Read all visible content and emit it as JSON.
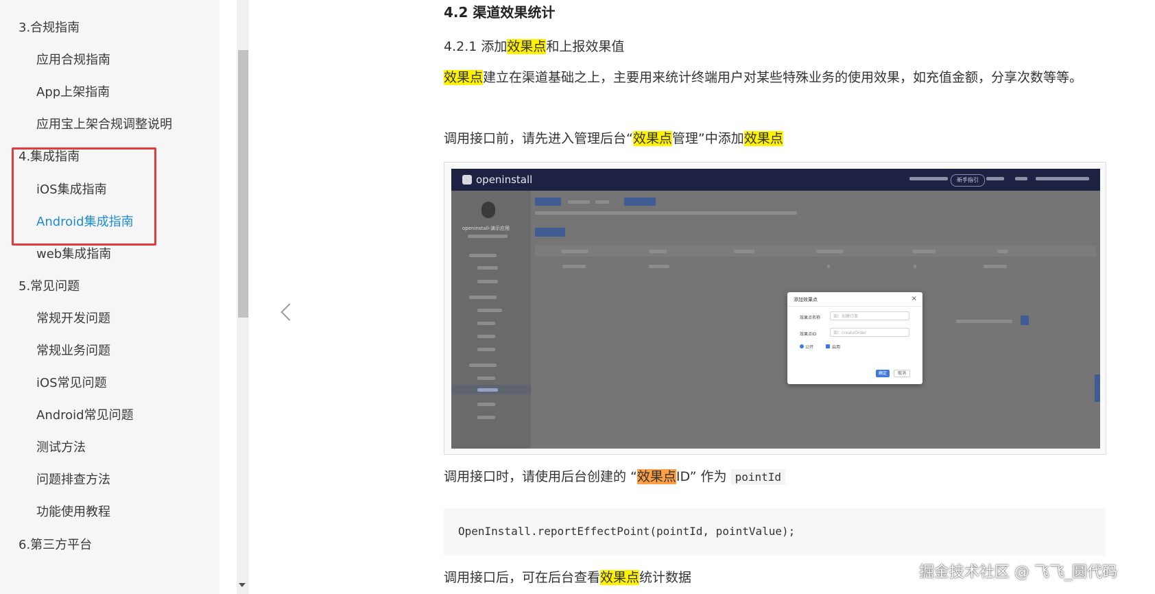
{
  "sidebar": {
    "items": [
      {
        "label": "3.合规指南",
        "level": 1
      },
      {
        "label": "应用合规指南",
        "level": 2
      },
      {
        "label": "App上架指南",
        "level": 2
      },
      {
        "label": "应用宝上架合规调整说明",
        "level": 2
      },
      {
        "label": "4.集成指南",
        "level": 1
      },
      {
        "label": "iOS集成指南",
        "level": 2
      },
      {
        "label": "Android集成指南",
        "level": 2,
        "active": true
      },
      {
        "label": "web集成指南",
        "level": 2
      },
      {
        "label": "5.常见问题",
        "level": 1
      },
      {
        "label": "常规开发问题",
        "level": 2
      },
      {
        "label": "常规业务问题",
        "level": 2
      },
      {
        "label": "iOS常见问题",
        "level": 2
      },
      {
        "label": "Android常见问题",
        "level": 2
      },
      {
        "label": "测试方法",
        "level": 2
      },
      {
        "label": "问题排查方法",
        "level": 2
      },
      {
        "label": "功能使用教程",
        "level": 2
      },
      {
        "label": "6.第三方平台",
        "level": 1
      }
    ],
    "active_color": "#1f8bd6",
    "highlight_color": "#e23b3b"
  },
  "article": {
    "heading": "4.2 渠道效果统计",
    "subheading": {
      "prefix": "4.2.1 添加",
      "highlight": "效果点",
      "suffix": "和上报效果值"
    },
    "para1": {
      "highlight": "效果点",
      "text": "建立在渠道基础之上，主要用来统计终端用户对某些特殊业务的使用效果，如充值金额，分享次数等等。"
    },
    "para2": {
      "prefix": "调用接口前，请先进入管理后台“",
      "highlight1": "效果点",
      "middle": "管理”中添加",
      "highlight2": "效果点"
    },
    "para3": {
      "prefix": "调用接口时，请使用后台创建的 “",
      "highlight": "效果点",
      "middle": "ID” 作为 ",
      "code": "pointId"
    },
    "code_block": "OpenInstall.reportEffectPoint(pointId, pointValue);",
    "para4": {
      "prefix": "调用接口后，可在后台查看",
      "highlight": "效果点",
      "suffix": "统计数据"
    }
  },
  "screenshot": {
    "logo": "openinstall",
    "topbar_button": "新手指引",
    "app_name": "openinstall-演示应用",
    "modal": {
      "title": "添加效果点",
      "close": "×",
      "name_label": "效果点名称",
      "name_placeholder": "如：创建订单",
      "id_label": "效果点ID",
      "id_placeholder": "如：createOrder",
      "public_label": "公开",
      "enable_label": "启用",
      "ok": "确定",
      "cancel": "取消"
    }
  },
  "watermark": "掘金技术社区 @ 飞飞_圆代码"
}
